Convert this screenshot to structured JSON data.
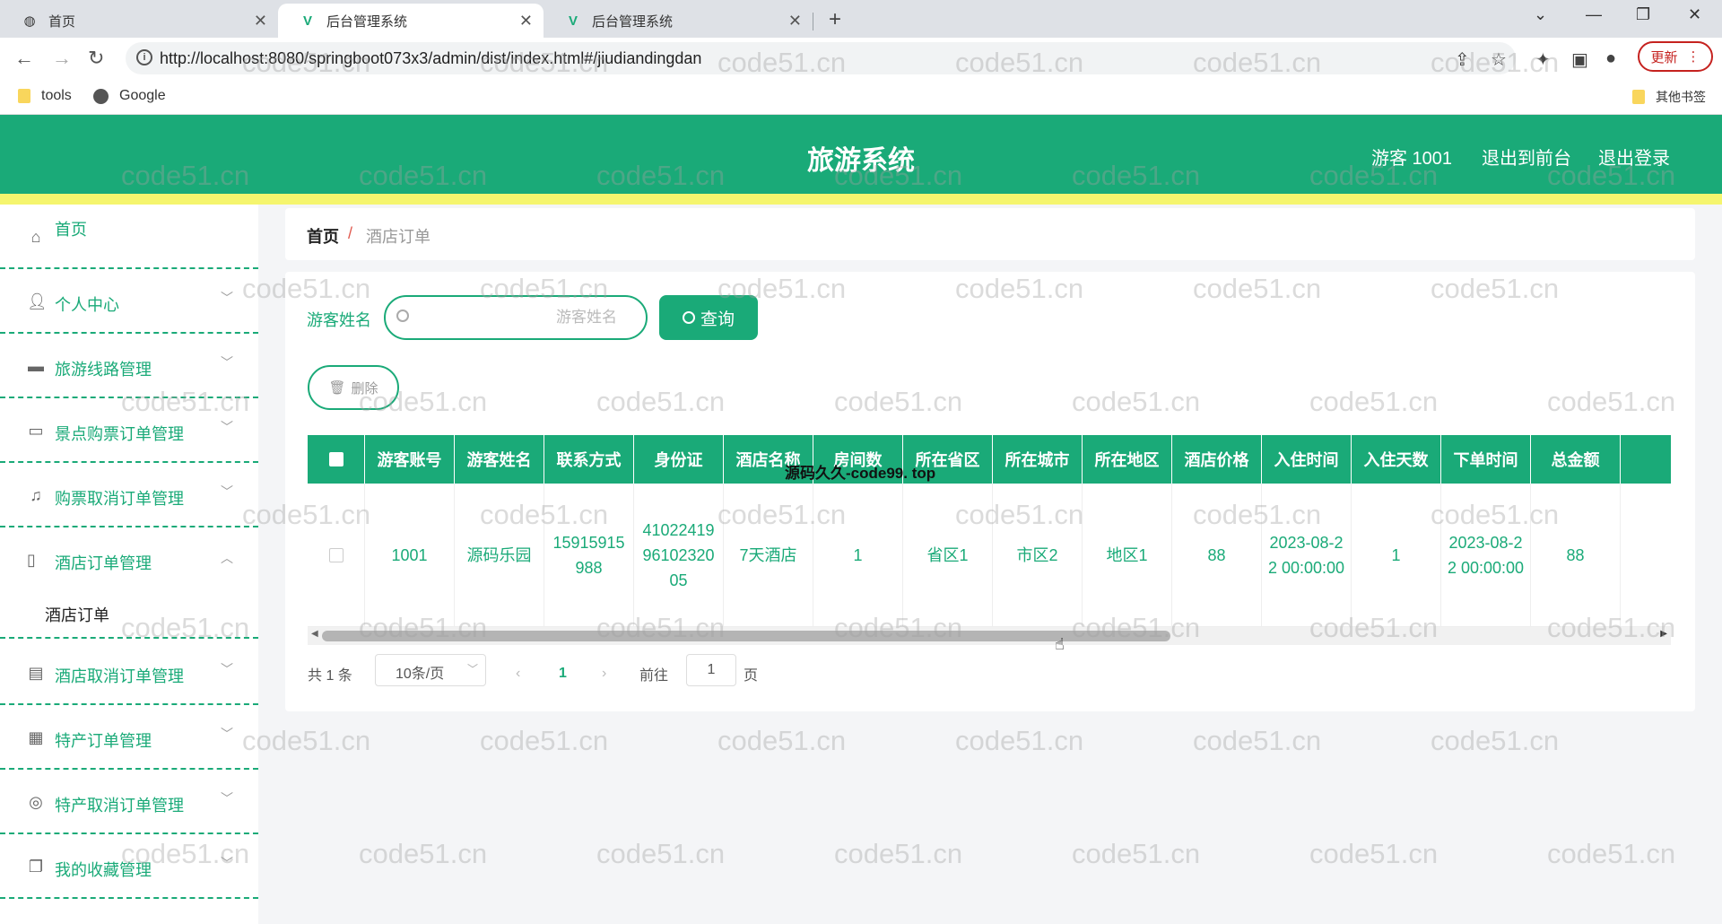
{
  "browser": {
    "tabs": [
      {
        "label": "首页"
      },
      {
        "label": "后台管理系统"
      },
      {
        "label": "后台管理系统"
      }
    ],
    "url": "http://localhost:8080/springboot073x3/admin/dist/index.html#/jiudiandingdan",
    "update_label": "更新",
    "bookmarks": [
      {
        "label": "tools"
      },
      {
        "label": "Google"
      }
    ],
    "other_bookmarks": "其他书签"
  },
  "header": {
    "title": "旅游系统",
    "user": "游客 1001",
    "to_frontend": "退出到前台",
    "logout": "退出登录"
  },
  "sidebar": {
    "items": [
      {
        "label": "首页",
        "icon": "home-icon"
      },
      {
        "label": "个人中心",
        "icon": "user-icon"
      },
      {
        "label": "旅游线路管理",
        "icon": "briefcase-icon"
      },
      {
        "label": "景点购票订单管理",
        "icon": "message-icon"
      },
      {
        "label": "购票取消订单管理",
        "icon": "bell-off-icon"
      },
      {
        "label": "酒店订单管理",
        "icon": "phone-icon"
      },
      {
        "label": "酒店取消订单管理",
        "icon": "document-icon"
      },
      {
        "label": "特产订单管理",
        "icon": "grid-icon"
      },
      {
        "label": "特产取消订单管理",
        "icon": "globe-icon"
      },
      {
        "label": "我的收藏管理",
        "icon": "copy-icon"
      }
    ],
    "submenu": {
      "label": "酒店订单"
    }
  },
  "breadcrumb": {
    "home": "首页",
    "separator": "/",
    "current": "酒店订单"
  },
  "search": {
    "label": "游客姓名",
    "placeholder": "游客姓名",
    "button": "查询"
  },
  "delete_button": "删除",
  "table": {
    "columns": [
      "游客账号",
      "游客姓名",
      "联系方式",
      "身份证",
      "酒店名称",
      "房间数",
      "所在省区",
      "所在城市",
      "所在地区",
      "酒店价格",
      "入住时间",
      "入住天数",
      "下单时间",
      "总金额"
    ],
    "rows": [
      [
        "1001",
        "源码乐园",
        "15915915988",
        "410224199610232005",
        "7天酒店",
        "1",
        "省区1",
        "市区2",
        "地区1",
        "88",
        "2023-08-22 00:00:00",
        "1",
        "2023-08-22 00:00:00",
        "88"
      ]
    ]
  },
  "pagination": {
    "total": "共 1 条",
    "page_size": "10条/页",
    "current_page": "1",
    "goto_prefix": "前往",
    "goto_value": "1",
    "goto_suffix": "页"
  },
  "overlay": "源码久久-code99. top",
  "watermark": "code51.cn",
  "colors": {
    "accent": "#1aaa78",
    "strip": "#f5f56e"
  }
}
